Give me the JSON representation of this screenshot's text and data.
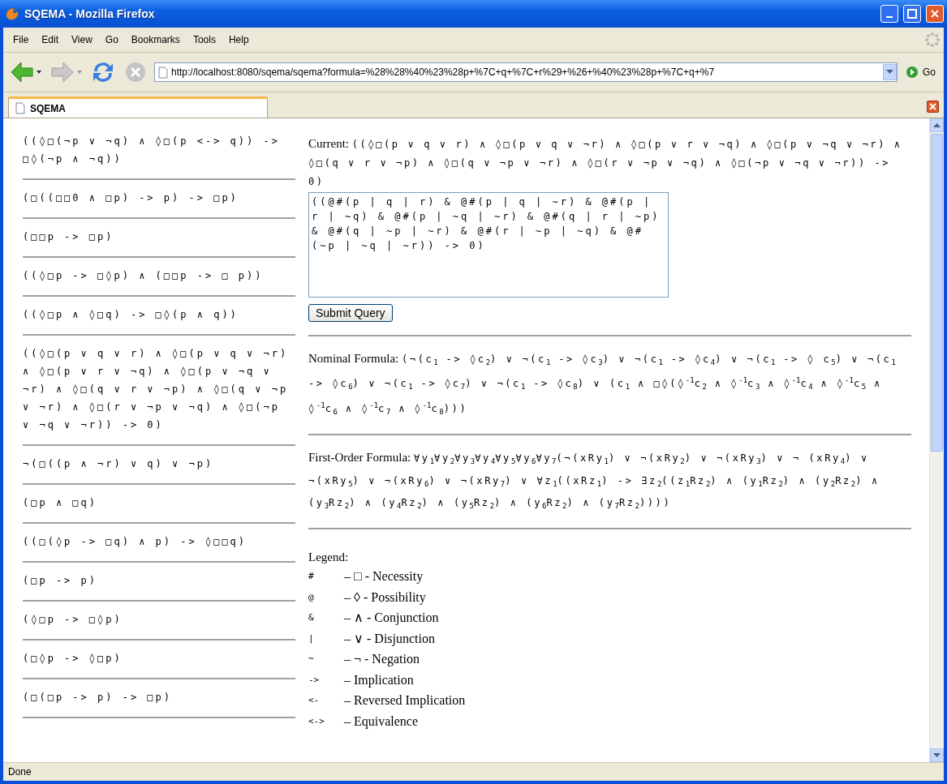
{
  "window": {
    "title": "SQEMA - Mozilla Firefox"
  },
  "menu": [
    "File",
    "Edit",
    "View",
    "Go",
    "Bookmarks",
    "Tools",
    "Help"
  ],
  "address": {
    "url": "http://localhost:8080/sqema/sqema?formula=%28%28%40%23%28p+%7C+q+%7C+r%29+%26+%40%23%28p+%7C+q+%7",
    "go": "Go"
  },
  "tabs": [
    {
      "label": "SQEMA",
      "selected": true
    }
  ],
  "formulas": [
    "((◊□(¬p ∨ ¬q) ∧ ◊□(p <-> q)) -> □◊(¬p ∧ ¬q))",
    "(□((□□0 ∧ □p) -> p) -> □p)",
    "(□□p -> □p)",
    "((◊□p -> □◊p) ∧ (□□p -> □ p))",
    "((◊□p ∧ ◊□q) -> □◊(p ∧ q))",
    "((◊□(p ∨ q ∨ r) ∧ ◊□(p ∨ q ∨ ¬r) ∧ ◊□(p ∨ r ∨ ¬q) ∧ ◊□(p ∨ ¬q ∨ ¬r) ∧ ◊□(q ∨ r ∨ ¬p) ∧ ◊□(q ∨ ¬p ∨ ¬r) ∧ ◊□(r ∨ ¬p ∨ ¬q) ∧ ◊□(¬p ∨ ¬q ∨ ¬r)) -> 0)",
    "¬(□((p ∧ ¬r) ∨ q) ∨ ¬p)",
    "(□p ∧ □q)",
    "((□(◊p -> □q) ∧ p) -> ◊□□q)",
    "(□p -> p)",
    "(◊□p -> □◊p)",
    "(□◊p -> ◊□p)",
    "(□(□p -> p) -> □p)"
  ],
  "current": {
    "label": "Current:",
    "formula": "((◊□(p ∨ q ∨ r) ∧ ◊□(p ∨ q ∨ ¬r) ∧ ◊□(p ∨ r ∨ ¬q) ∧ ◊□(p ∨ ¬q ∨ ¬r) ∧ ◊□(q ∨ r ∨ ¬p) ∧ ◊□(q ∨ ¬p ∨ ¬r) ∧ ◊□(r ∨ ¬p ∨ ¬q) ∧ ◊□(¬p ∨ ¬q ∨ ¬r)) -> 0)"
  },
  "query": {
    "value": "((@#(p | q | r) & @#(p | q | ~r) & @#(p | r | ~q) & @#(p | ~q | ~r) & @#(q | r | ~p) & @#(q | ~p | ~r) & @#(r | ~p | ~q) & @#(~p | ~q | ~r)) -> 0)",
    "button": "Submit Query"
  },
  "nominal": {
    "label": "Nominal Formula:",
    "formula": "(¬(c$_{1}$ -> ◊c$_{2}$) ∨ ¬(c$_{1}$ -> ◊c$_{3}$) ∨ ¬(c$_{1}$ -> ◊c$_{4}$) ∨ ¬(c$_{1}$ -> ◊ c$_{5}$) ∨ ¬(c$_{1}$ -> ◊c$_{6}$) ∨ ¬(c$_{1}$ -> ◊c$_{7}$) ∨ ¬(c$_{1}$ -> ◊c$_{8}$) ∨ (c$_{1}$ ∧ □◊(◊$^{-1}$c$_{2}$ ∧ ◊$^{-1}$c$_{3}$ ∧ ◊$^{-1}$c$_{4}$ ∧ ◊$^{-1}$c$_{5}$ ∧ ◊$^{-1}$c$_{6}$ ∧ ◊$^{-1}$c$_{7}$ ∧ ◊$^{-1}$c$_{8}$)))"
  },
  "first_order": {
    "label": "First-Order Formula:",
    "formula": "∀y$_{1}$∀y$_{2}$∀y$_{3}$∀y$_{4}$∀y$_{5}$∀y$_{6}$∀y$_{7}$(¬(xRy$_{1}$) ∨ ¬(xRy$_{2}$) ∨ ¬(xRy$_{3}$) ∨ ¬ (xRy$_{4}$) ∨ ¬(xRy$_{5}$) ∨ ¬(xRy$_{6}$) ∨ ¬(xRy$_{7}$) ∨ ∀z$_{1}$((xRz$_{1}$) -> ∃z$_{2}$((z$_{1}$Rz$_{2}$) ∧ (y$_{1}$Rz$_{2}$) ∧ (y$_{2}$Rz$_{2}$) ∧ (y$_{3}$Rz$_{2}$) ∧ (y$_{4}$Rz$_{2}$) ∧ (y$_{5}$Rz$_{2}$) ∧ (y$_{6}$Rz$_{2}$) ∧ (y$_{7}$Rz$_{2}$))))"
  },
  "legend": {
    "title": "Legend:",
    "rows": [
      {
        "symbol": "#",
        "text": "– □ - Necessity"
      },
      {
        "symbol": "@",
        "text": "– ◊ - Possibility"
      },
      {
        "symbol": "&",
        "text": "– ∧ - Conjunction"
      },
      {
        "symbol": "|",
        "text": "– ∨ - Disjunction"
      },
      {
        "symbol": "~",
        "text": "– ¬ - Negation"
      },
      {
        "symbol": "->",
        "text": "– Implication"
      },
      {
        "symbol": "<-",
        "text": "– Reversed Implication"
      },
      {
        "symbol": "<->",
        "text": "– Equivalence"
      }
    ]
  },
  "status_bar": {
    "text": "Done"
  }
}
